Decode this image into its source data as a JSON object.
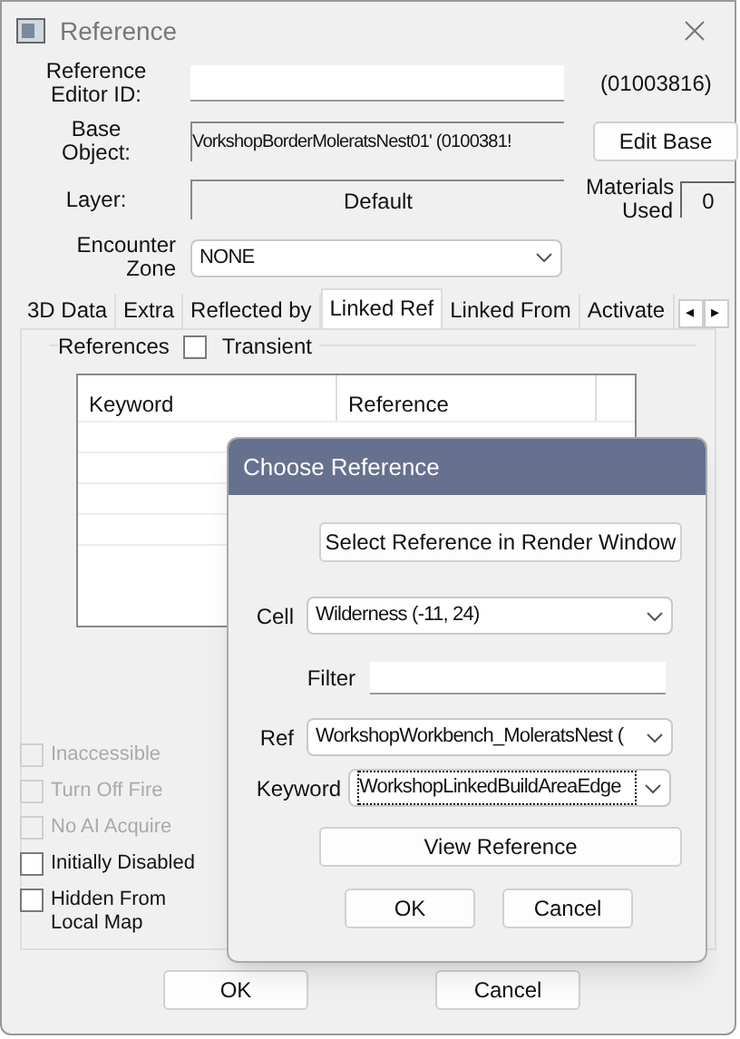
{
  "window": {
    "title": "Reference"
  },
  "fields": {
    "editor_id_label": "Reference Editor ID:",
    "form_id": "(01003816)",
    "base_label": "Base Object:",
    "base_value": "VorkshopBorderMoleratsNest01' (0100381!",
    "edit_base": "Edit Base",
    "layer_label": "Layer:",
    "layer_value": "Default",
    "materials_label": "Materials Used",
    "materials_value": "0",
    "zone_label": "Encounter Zone",
    "zone_value": "NONE"
  },
  "tabs": [
    {
      "label": "3D Data",
      "selected": false
    },
    {
      "label": "Extra",
      "selected": false
    },
    {
      "label": "Reflected by",
      "selected": false
    },
    {
      "label": "Linked Ref",
      "selected": true
    },
    {
      "label": "Linked From",
      "selected": false
    },
    {
      "label": "Activate",
      "selected": false
    }
  ],
  "tab_scroll": {
    "left": "◂",
    "right": "▸"
  },
  "references": {
    "title": "References",
    "transient": {
      "label": "Transient",
      "checked": false
    },
    "columns": [
      "Keyword",
      "Reference"
    ]
  },
  "options": [
    {
      "label": "Inaccessible",
      "checked": false,
      "disabled": true
    },
    {
      "label": "Turn Off Fire",
      "checked": false,
      "disabled": true
    },
    {
      "label": "No AI Acquire",
      "checked": false,
      "disabled": true
    },
    {
      "label": "Initially Disabled",
      "checked": false,
      "disabled": false
    },
    {
      "label": "Hidden From Local Map",
      "checked": false,
      "disabled": false
    }
  ],
  "buttons": [
    "OK",
    "Cancel"
  ],
  "dialog": {
    "title": "Choose Reference",
    "select_button": "Select Reference in Render Window",
    "cell_label": "Cell",
    "cell_value": "Wilderness (-11, 24)",
    "filter_label": "Filter",
    "ref_label": "Ref",
    "ref_value": "WorkshopWorkbench_MoleratsNest (",
    "keyword_label": "Keyword",
    "keyword_value": "WorkshopLinkedBuildAreaEdge",
    "view_button": "View Reference",
    "buttons": [
      "OK",
      "Cancel"
    ]
  }
}
